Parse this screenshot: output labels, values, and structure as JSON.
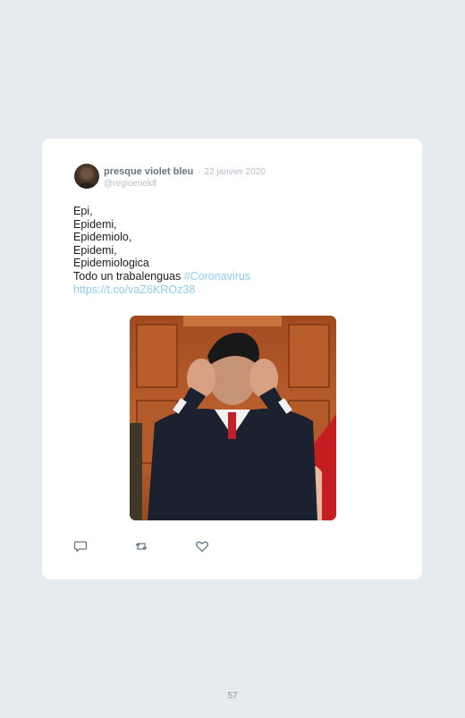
{
  "tweet": {
    "author_name": "presque violet bleu",
    "separator": "·",
    "date": "22 janvier 2020",
    "handle": "@regioeneklf",
    "lines": [
      "Epi,",
      "Epidemi,",
      "Epidemiolo,",
      "Epidemi,",
      "Epidemiologica"
    ],
    "last_line_text": "Todo un trabalenguas ",
    "hashtag": "#Coronavirus",
    "url": "https://t.co/vaZ6KROz38",
    "media_icon": "gif-video-still",
    "actions": [
      {
        "name": "reply",
        "icon": "speech-bubble-icon"
      },
      {
        "name": "retweet",
        "icon": "retweet-icon"
      },
      {
        "name": "like",
        "icon": "heart-icon"
      }
    ]
  },
  "page": {
    "number": "57"
  },
  "colors": {
    "background": "#e6ebef",
    "card": "#ffffff",
    "link": "#8ecdf0",
    "muted": "#b6c0c7",
    "author": "#66757f"
  }
}
